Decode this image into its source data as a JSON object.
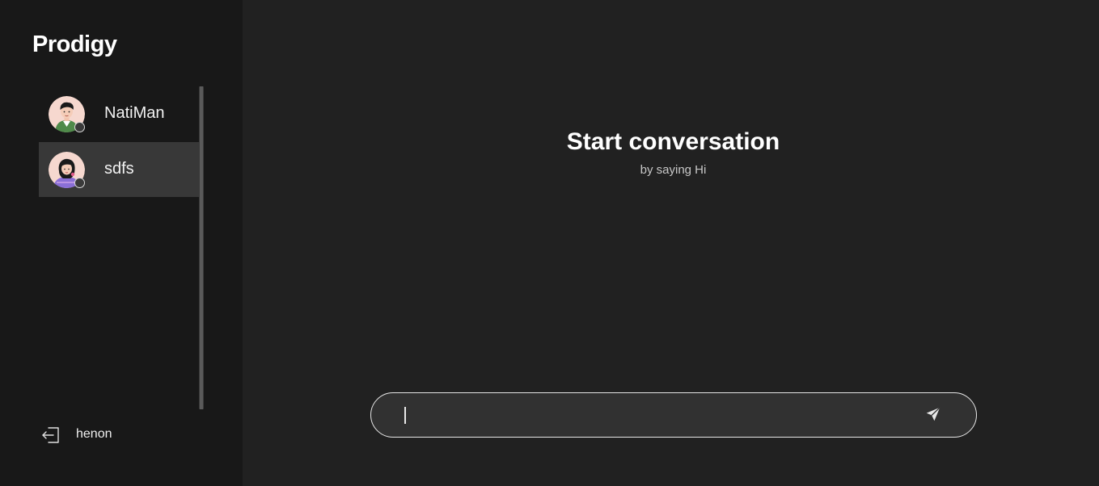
{
  "app": {
    "brand": "Prodigy"
  },
  "sidebar": {
    "contacts": [
      {
        "name": "NatiMan",
        "avatar": "man-avatar-icon",
        "status": "offline",
        "selected": false
      },
      {
        "name": "sdfs",
        "avatar": "woman-avatar-icon",
        "status": "offline",
        "selected": true
      }
    ],
    "account": {
      "username": "henon",
      "icon": "logout-icon"
    }
  },
  "main": {
    "empty_state": {
      "title": "Start conversation",
      "subtitle": "by saying Hi"
    },
    "composer": {
      "value": "",
      "placeholder": "",
      "send_icon": "send-icon"
    }
  },
  "colors": {
    "sidebar_bg": "#181818",
    "main_bg": "#212121",
    "selected_item_bg": "#383838",
    "composer_bg": "#313131",
    "text": "#ffffff"
  }
}
